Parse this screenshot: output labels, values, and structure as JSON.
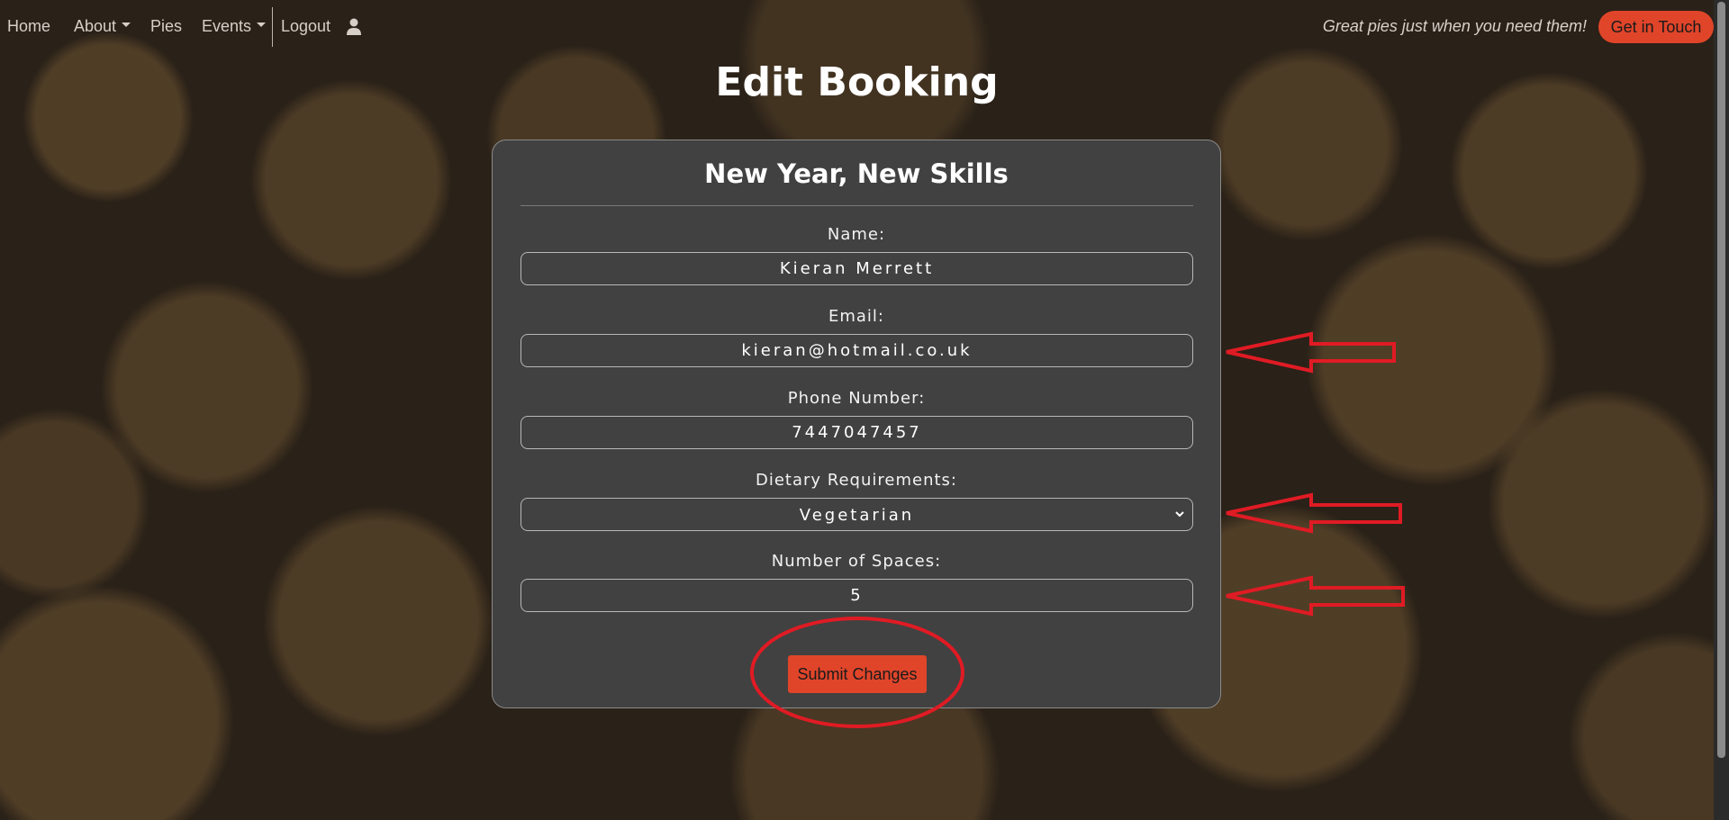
{
  "nav": {
    "home": "Home",
    "about": "About",
    "pies": "Pies",
    "events": "Events",
    "logout": "Logout",
    "tagline": "Great pies just when you need them!",
    "cta": "Get in Touch"
  },
  "page": {
    "title": "Edit Booking"
  },
  "form": {
    "event_title": "New Year, New Skills",
    "name_label": "Name:",
    "name_value": "Kieran Merrett",
    "email_label": "Email:",
    "email_value": "kieran@hotmail.co.uk",
    "phone_label": "Phone Number:",
    "phone_value": "7447047457",
    "dietary_label": "Dietary Requirements:",
    "dietary_value": "Vegetarian",
    "spaces_label": "Number of Spaces:",
    "spaces_value": "5",
    "submit_label": "Submit Changes"
  },
  "colors": {
    "accent": "#e0452a",
    "card": "#414141",
    "annotation": "#e01b24"
  },
  "icons": [
    "user-icon",
    "caret-down-icon",
    "chevron-down-icon"
  ]
}
